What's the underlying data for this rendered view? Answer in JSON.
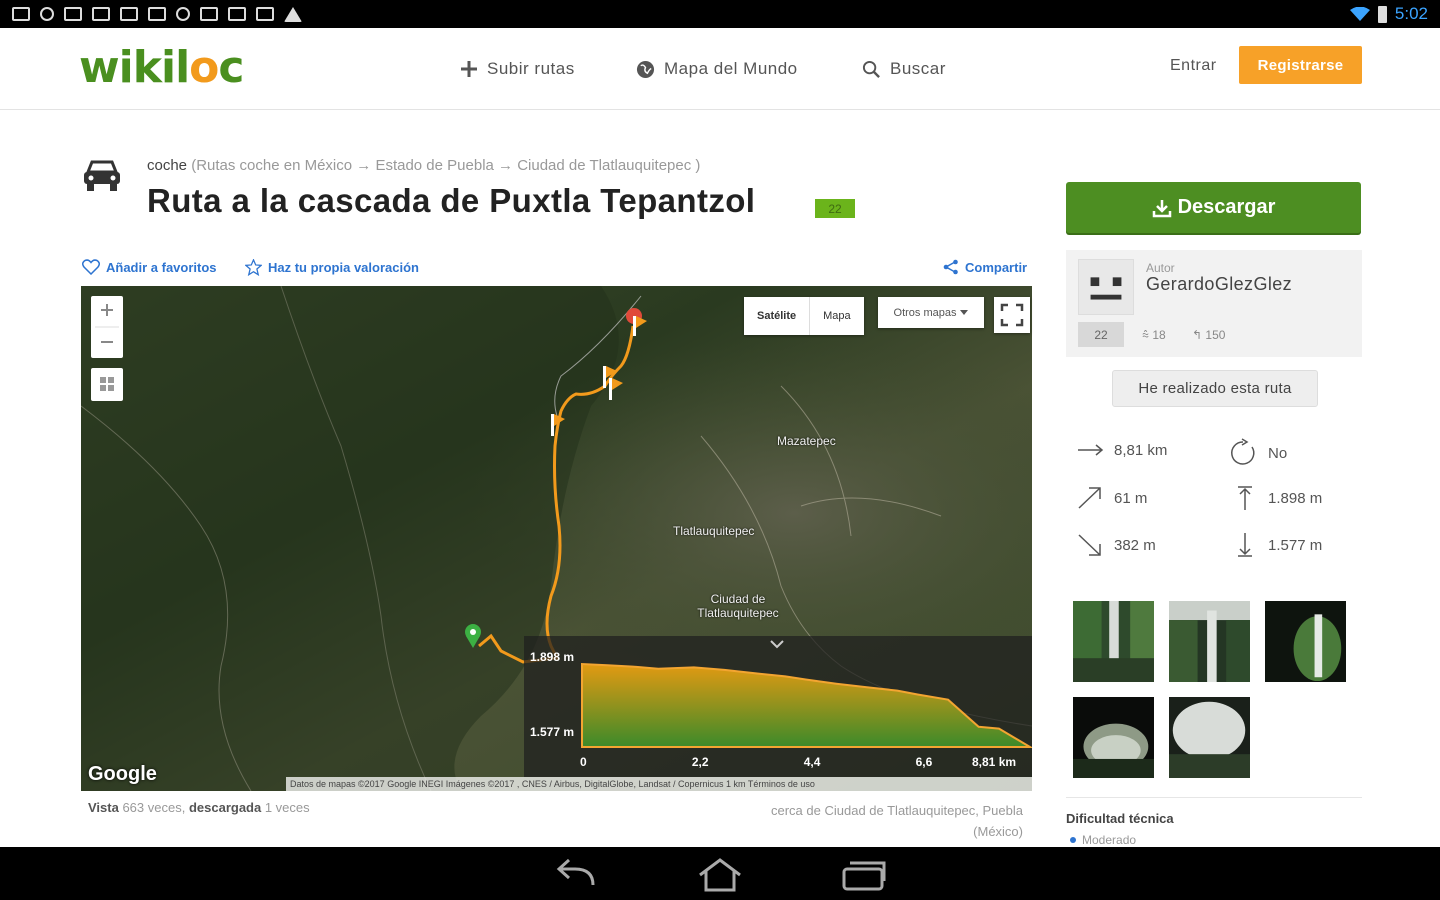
{
  "status_bar": {
    "time": "5:02"
  },
  "header": {
    "logo_main": "wikil",
    "logo_o": "o",
    "logo_end": "c",
    "nav": [
      {
        "icon": "plus-icon",
        "label": "Subir rutas"
      },
      {
        "icon": "globe-icon",
        "label": "Mapa del Mundo"
      },
      {
        "icon": "search-icon",
        "label": "Buscar"
      }
    ],
    "login": "Entrar",
    "register": "Registrarse"
  },
  "route": {
    "category": "coche",
    "breadcrumb_rest": " (Rutas coche en México → Estado de Puebla → Ciudad de Tlatlauquitepec )",
    "title": "Ruta a la cascada de Puxtla Tepantzol",
    "badge": "22",
    "actions": {
      "favorite": "Añadir a favoritos",
      "rate": "Haz tu propia valoración",
      "share": "Compartir"
    }
  },
  "map": {
    "type_satellite": "Satélite",
    "type_map": "Mapa",
    "other_maps": "Otros mapas",
    "towns": [
      "Mazatepec",
      "Tlatlauquitepec",
      "Ciudad de Tlatlauquitepec"
    ],
    "google": "Google",
    "attribution": "Datos de mapas ©2017 Google INEGI Imágenes ©2017 , CNES / Airbus, DigitalGlobe, Landsat / Copernicus   1 km  Términos de uso"
  },
  "elevation": {
    "max_label": "1.898 m",
    "min_label": "1.577 m",
    "x_ticks": [
      "0",
      "2,2",
      "4,4",
      "6,6",
      "8,81 km"
    ]
  },
  "chart_data": {
    "type": "area",
    "title": "",
    "xlabel": "",
    "ylabel": "",
    "x": [
      0,
      0.5,
      1.0,
      1.5,
      2.2,
      2.8,
      3.4,
      4.0,
      4.4,
      5.0,
      5.6,
      6.2,
      6.6,
      7.2,
      7.8,
      8.2,
      8.81
    ],
    "y": [
      1898,
      1893,
      1888,
      1880,
      1885,
      1875,
      1862,
      1850,
      1838,
      1822,
      1808,
      1795,
      1780,
      1760,
      1655,
      1648,
      1577
    ],
    "xlim": [
      0,
      8.81
    ],
    "ylim": [
      1577,
      1898
    ]
  },
  "views": {
    "label_views": "Vista",
    "views_count": " 663 veces, ",
    "label_downloaded": "descargada",
    "downloads_count": " 1 veces",
    "near_line1": "cerca de Ciudad de Tlatlauquitepec, Puebla",
    "near_line2": "(México)"
  },
  "sidebar": {
    "download": "Descargar",
    "author_label": "Autor",
    "author_name": "GerardoGlezGlez",
    "author_badge": "22",
    "author_stat_routes": "18",
    "author_stat_followers": "150",
    "done_button": "He realizado esta ruta",
    "metrics": {
      "distance": "8,81 km",
      "loop": "No",
      "up": "61 m",
      "max_alt": "1.898 m",
      "down": "382 m",
      "min_alt": "1.577 m"
    },
    "difficulty_title": "Dificultad técnica",
    "difficulty_value": "Moderado"
  }
}
